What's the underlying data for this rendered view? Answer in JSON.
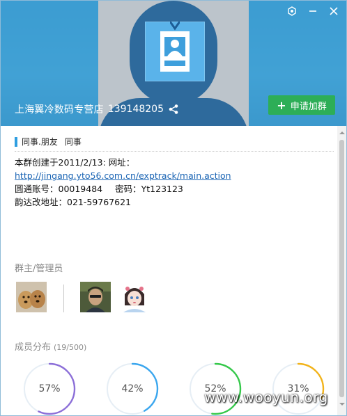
{
  "window": {
    "title_buttons": [
      "settings-icon",
      "minimize-icon",
      "close-icon"
    ]
  },
  "header": {
    "group_name": "上海翼冷数码专营店",
    "group_id": "139148205",
    "join_button": "申请加群",
    "colors": {
      "header_bg": "#3e9fd4",
      "join_bg": "#2dae57"
    }
  },
  "tags": {
    "items": [
      "同事.朋友",
      "同事"
    ]
  },
  "description": {
    "line1": "本群创建于2011/2/13:  网址：",
    "link": "http://jingang.yto56.com.cn/exptrack/main.action",
    "line3_a": "圆通账号：00019484",
    "line3_b": "密码：Yt123123",
    "line4": "韵达改地址：021-59767621"
  },
  "admins": {
    "title": "群主/管理员",
    "avatars": [
      "owner-avatar-dogs",
      "admin-avatar-man",
      "admin-avatar-girl"
    ]
  },
  "members": {
    "title": "成员分布",
    "count": "(19/500)",
    "rings": [
      {
        "label": "57%",
        "value": 0.57,
        "color": "#8c6fd8"
      },
      {
        "label": "42%",
        "value": 0.42,
        "color": "#3aa6ee"
      },
      {
        "label": "52%",
        "value": 0.52,
        "color": "#35c84a"
      },
      {
        "label": "31%",
        "value": 0.31,
        "color": "#f2b31a"
      }
    ]
  },
  "watermark": "www.wooyun.org"
}
